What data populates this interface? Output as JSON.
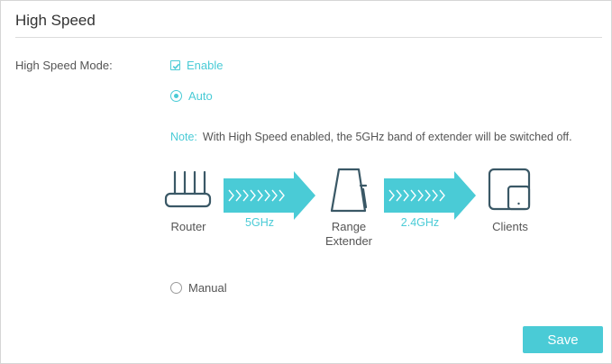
{
  "section": {
    "title": "High Speed"
  },
  "mode": {
    "label": "High Speed Mode:",
    "enable_label": "Enable",
    "enable_checked": true,
    "auto_label": "Auto",
    "manual_label": "Manual",
    "selected": "Auto"
  },
  "note": {
    "prefix": "Note:",
    "text": "With High Speed enabled, the 5GHz band of extender will be switched off."
  },
  "diagram": {
    "router_label": "Router",
    "band1_label": "5GHz",
    "extender_label_line1": "Range",
    "extender_label_line2": "Extender",
    "band2_label": "2.4GHz",
    "clients_label": "Clients"
  },
  "actions": {
    "save_label": "Save"
  },
  "colors": {
    "accent": "#4acbd6",
    "text": "#555555"
  }
}
